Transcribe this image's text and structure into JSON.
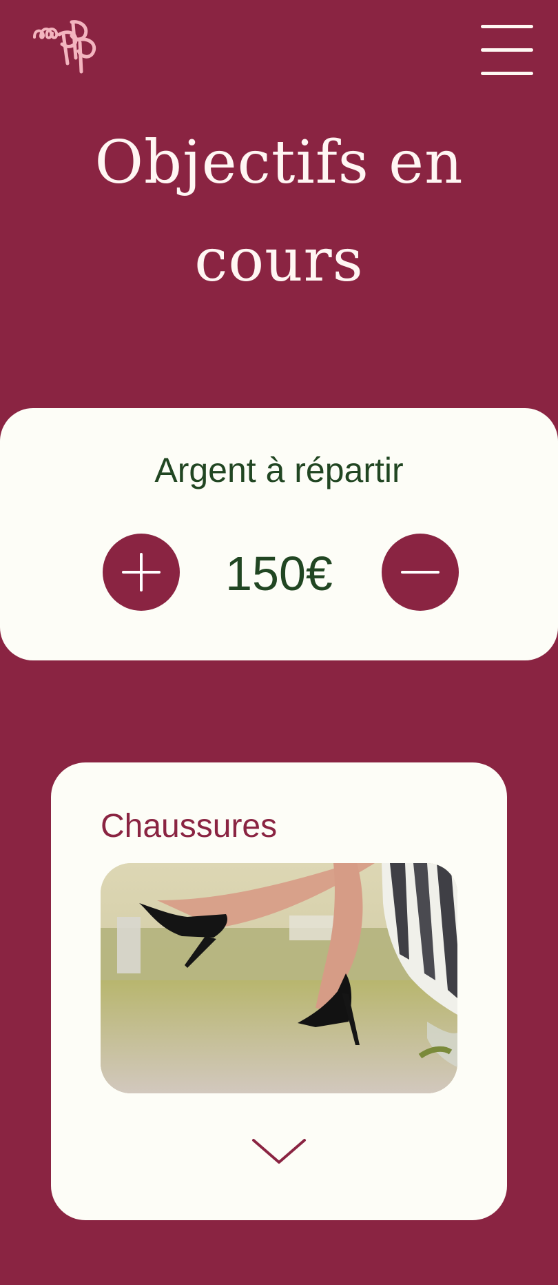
{
  "header": {
    "logo_icon": "pp-logo-icon",
    "menu_icon": "hamburger-menu-icon"
  },
  "page": {
    "title": "Objectifs en cours"
  },
  "budget": {
    "title": "Argent à répartir",
    "amount": "150€",
    "increase_icon": "plus-icon",
    "decrease_icon": "minus-icon"
  },
  "goal": {
    "title": "Chaussures",
    "image_icon": "shoe-photo-icon",
    "expand_icon": "chevron-down-icon"
  },
  "colors": {
    "background": "#8a2442",
    "card": "#fdfdf7",
    "green_text": "#214622",
    "accent": "#8a2442",
    "logo_pink": "#f3b5bf"
  }
}
